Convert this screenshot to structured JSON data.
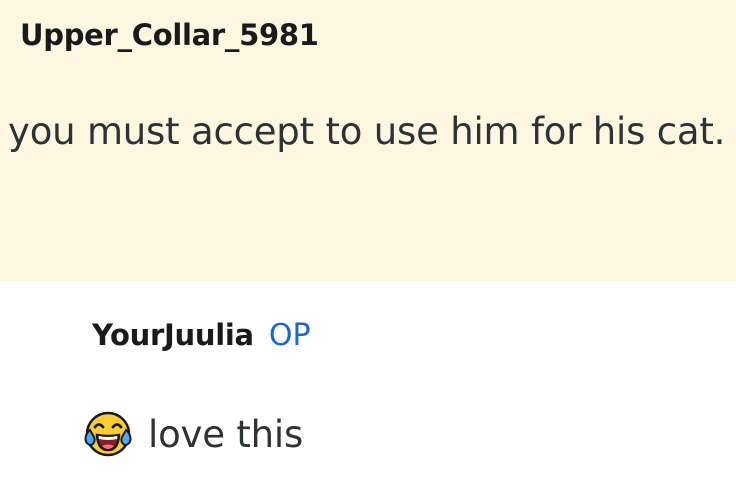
{
  "comment": {
    "author": "Upper_Collar_5981",
    "text": "you must accept to use him for his cat."
  },
  "reply": {
    "author": "YourJuulia",
    "badge": "OP",
    "emoji_icon": "tears-of-joy-emoji",
    "text": "love this"
  },
  "colors": {
    "highlight_bg": "#fdf7e1",
    "op_badge": "#1f66c8",
    "text": "#2f3234"
  }
}
